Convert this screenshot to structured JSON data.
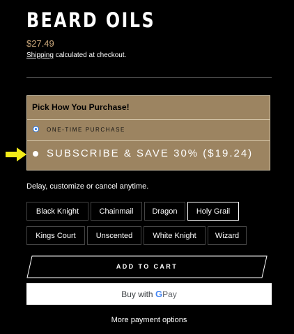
{
  "product": {
    "title": "BEARD OILS",
    "price": "$27.49",
    "shipping_link": "Shipping",
    "shipping_text": " calculated at checkout."
  },
  "purchase": {
    "header": "Pick How You Purchase!",
    "one_time_label": "ONE-TIME PURCHASE",
    "subscribe_label": "SUBSCRIBE & SAVE 30% ($19.24)",
    "selected": "subscribe",
    "note": "Delay, customize or cancel anytime."
  },
  "variants": [
    {
      "label": "Black Knight",
      "selected": false
    },
    {
      "label": "Chainmail",
      "selected": false
    },
    {
      "label": "Dragon",
      "selected": false
    },
    {
      "label": "Holy Grail",
      "selected": true
    },
    {
      "label": "Kings Court",
      "selected": false
    },
    {
      "label": "Unscented",
      "selected": false
    },
    {
      "label": "White Knight",
      "selected": false
    },
    {
      "label": "Wizard",
      "selected": false
    }
  ],
  "actions": {
    "add_to_cart": "ADD TO CART",
    "gpay_prefix": "Buy with",
    "gpay_g": "G",
    "gpay_pay": "Pay",
    "more_options": "More payment options"
  },
  "colors": {
    "price": "#c9a67a",
    "purchase_box": "#9c8461",
    "arrow": "#f3ec19"
  },
  "icons": {
    "annotation_arrow": "yellow-arrow-icon",
    "google_pay": "google-g-icon"
  }
}
